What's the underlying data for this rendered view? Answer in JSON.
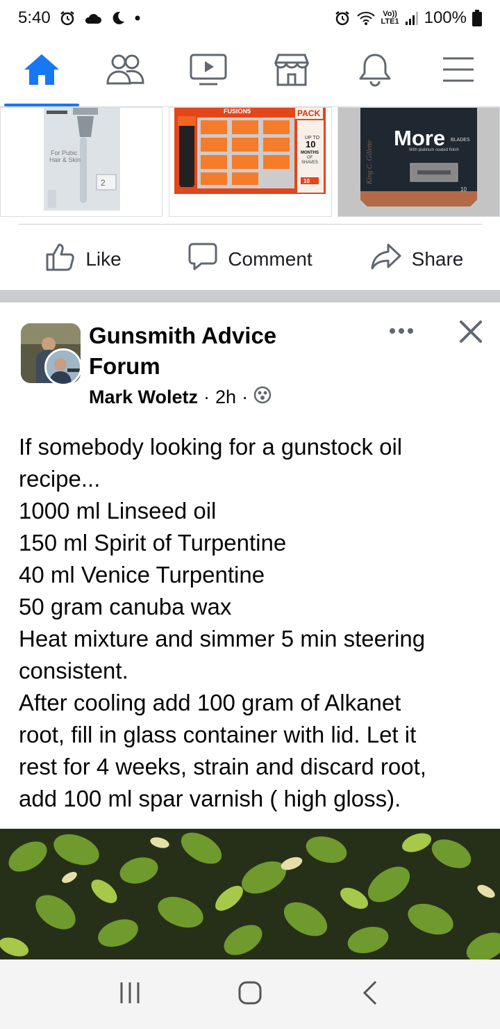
{
  "status_bar": {
    "time": "5:40",
    "battery": "100%",
    "network_top": "Vo))",
    "network_bottom": "LTE1"
  },
  "nav": {
    "tabs": [
      {
        "icon": "home-icon",
        "active": true
      },
      {
        "icon": "friends-icon",
        "active": false
      },
      {
        "icon": "video-icon",
        "active": false
      },
      {
        "icon": "marketplace-icon",
        "active": false
      },
      {
        "icon": "notifications-bell-icon",
        "active": false
      },
      {
        "icon": "menu-hamburger-icon",
        "active": false
      }
    ],
    "accent_color": "#1877f2"
  },
  "carousel": {
    "card1": {
      "label": "For Pubic Hair & Skin",
      "badge": "2"
    },
    "card2": {
      "brand": "FUSION5",
      "pack": "PACK",
      "up_to": "UP TO",
      "months_num": "10",
      "months": "MONTHS",
      "of": "OF",
      "shaves": "SHAVES",
      "count": "10"
    },
    "card3": {
      "label": "More",
      "sub1": "BLADES",
      "sub2": "With platinum coated finish",
      "count": "10"
    }
  },
  "actions": {
    "like": "Like",
    "comment": "Comment",
    "share": "Share"
  },
  "post": {
    "group_name_line1": "Gunsmith Advice",
    "group_name_line2": "Forum",
    "author": "Mark Woletz",
    "sep1": "·",
    "time": "2h",
    "sep2": "·",
    "lines": [
      "If somebody looking for a gunstock oil",
      "recipe...",
      "1000 ml Linseed oil",
      "150 ml Spirit of Turpentine",
      "40 ml Venice Turpentine",
      "50 gram canuba wax",
      "Heat mixture and simmer 5 min steering",
      "consistent.",
      "After cooling add 100 gram of Alkanet",
      "root, fill in glass container with lid. Let it",
      "rest for 4 weeks, strain and discard root,",
      "add 100 ml spar varnish ( high gloss)."
    ]
  }
}
